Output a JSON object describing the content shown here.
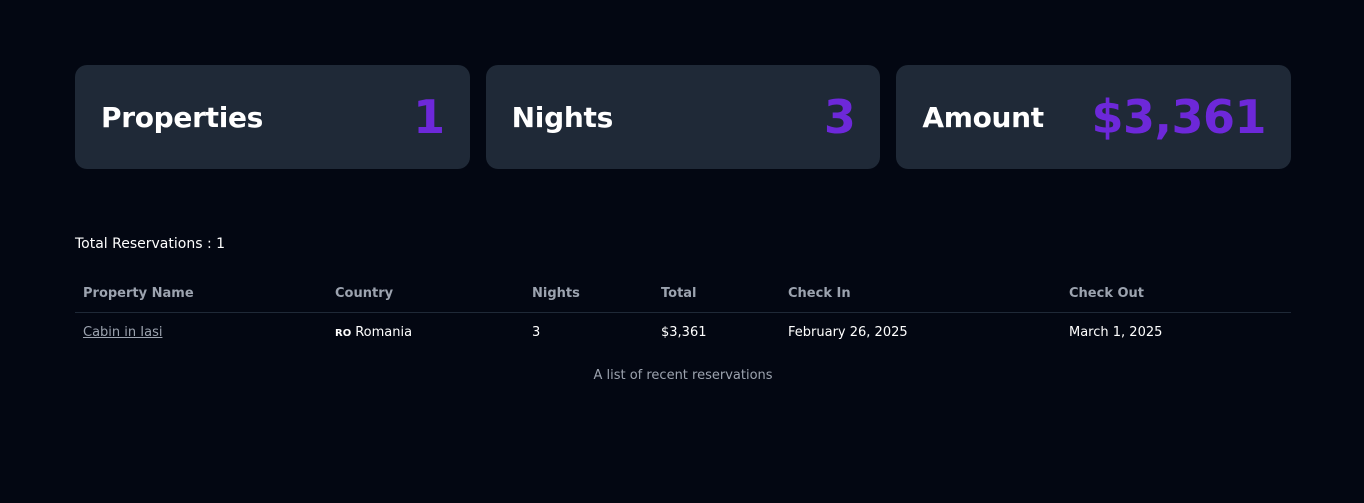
{
  "stats": [
    {
      "label": "Properties",
      "value": "1"
    },
    {
      "label": "Nights",
      "value": "3"
    },
    {
      "label": "Amount",
      "value": "$3,361"
    }
  ],
  "reservations": {
    "total_text": "Total Reservations : 1",
    "columns": [
      "Property Name",
      "Country",
      "Nights",
      "Total",
      "Check In",
      "Check Out"
    ],
    "rows": [
      {
        "property": "Cabin in Iasi",
        "country_flag": "RO",
        "country": "Romania",
        "nights": "3",
        "total": "$3,361",
        "check_in": "February 26, 2025",
        "check_out": "March 1, 2025"
      }
    ],
    "caption": "A list of recent reservations"
  },
  "colors": {
    "background": "#030712",
    "card": "#1f2937",
    "accent": "#6d28d9",
    "muted": "#9ca3af"
  }
}
